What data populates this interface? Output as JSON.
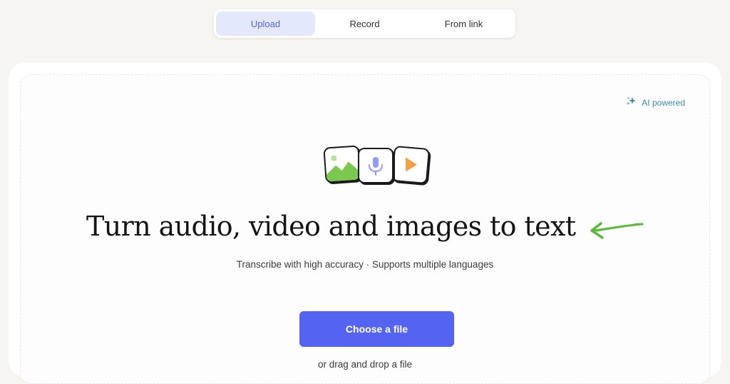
{
  "tabs": [
    {
      "label": "Upload",
      "active": true
    },
    {
      "label": "Record",
      "active": false
    },
    {
      "label": "From link",
      "active": false
    }
  ],
  "badge": {
    "label": "AI powered",
    "icon": "sparkle-icon"
  },
  "icons": [
    "image-icon",
    "microphone-icon",
    "play-icon"
  ],
  "headline": "Turn audio, video and images to text",
  "subtitle": "Transcribe with high accuracy · Supports multiple languages",
  "cta": {
    "label": "Choose a file"
  },
  "drop_hint": "or drag and drop a file",
  "colors": {
    "accent": "#5463f2",
    "active_tab_bg": "#e3e8fc",
    "arrow": "#5cb83a",
    "badge": "#3a8ea6"
  }
}
